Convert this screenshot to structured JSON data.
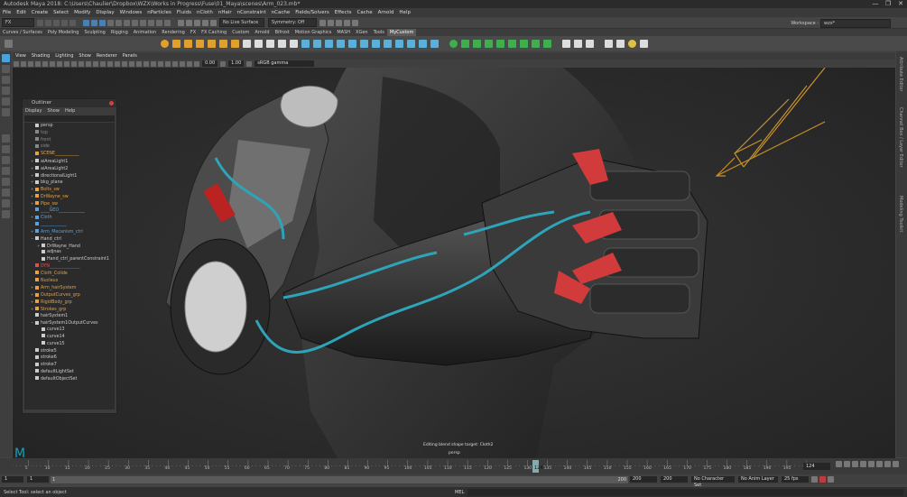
{
  "window": {
    "title": "Autodesk Maya 2018: C:\\Users\\Chaulier\\Dropbox\\WZX\\Works in Progress\\Fuse\\01_Maya\\scenes\\Arm_023.mb*",
    "buttons": [
      "—",
      "❐",
      "✕"
    ]
  },
  "menu": [
    "File",
    "Edit",
    "Create",
    "Select",
    "Modify",
    "Display",
    "Windows",
    "nParticles",
    "Fluids",
    "nCloth",
    "nHair",
    "nConstraint",
    "nCache",
    "Fields/Solvers",
    "Effects",
    "Cache",
    "Arnold",
    "Help"
  ],
  "status_line": {
    "mode": "FX",
    "live_surface": "No Live Surface",
    "symmetry": "Symmetry: Off"
  },
  "workspace": {
    "label": "Workspace :",
    "value": "wzx*"
  },
  "shelf_tabs": [
    "Curves / Surfaces",
    "Poly Modeling",
    "Sculpting",
    "Rigging",
    "Animation",
    "Rendering",
    "FX",
    "FX Caching",
    "Custom",
    "Arnold",
    "Bifrost",
    "Motion Graphics",
    "MASH",
    "XGen",
    "Tools",
    "MyCustom"
  ],
  "active_shelf_tab": "MyCustom",
  "viewport": {
    "menu": [
      "View",
      "Shading",
      "Lighting",
      "Show",
      "Renderer",
      "Panels"
    ],
    "field_a": "0.00",
    "field_b": "1.00",
    "colorspace": "sRGB gamma",
    "hud_message": "Editing blend shape target: Cloth2",
    "camera": "persp"
  },
  "right_panels": [
    "Attribute Editor",
    "Channel Box / Layer Editor",
    "Modeling Toolkit"
  ],
  "outliner": {
    "title": "Outliner",
    "menu": [
      "Display",
      "Show",
      "Help"
    ],
    "items": [
      {
        "label": "persp",
        "color": "#cccccc",
        "indent": 1,
        "expand": ""
      },
      {
        "label": "top",
        "color": "#888888",
        "indent": 1,
        "expand": ""
      },
      {
        "label": "front",
        "color": "#888888",
        "indent": 1,
        "expand": ""
      },
      {
        "label": "side",
        "color": "#888888",
        "indent": 1,
        "expand": ""
      },
      {
        "label": "SCENE___________",
        "color": "#e8a040",
        "indent": 1,
        "expand": ""
      },
      {
        "label": "aiAreaLight1",
        "color": "#cccccc",
        "indent": 1,
        "expand": "+"
      },
      {
        "label": "aiAreaLight2",
        "color": "#cccccc",
        "indent": 1,
        "expand": "+"
      },
      {
        "label": "directionalLight1",
        "color": "#cccccc",
        "indent": 1,
        "expand": "+"
      },
      {
        "label": "bkg_plane",
        "color": "#cccccc",
        "indent": 1,
        "expand": "+"
      },
      {
        "label": "Bolts_sw",
        "color": "#e8a040",
        "indent": 1,
        "expand": "+"
      },
      {
        "label": "DrWayne_sw",
        "color": "#e8a040",
        "indent": 1,
        "expand": "+"
      },
      {
        "label": "Pipe_sw",
        "color": "#e8a040",
        "indent": 1,
        "expand": "+"
      },
      {
        "label": "____GEO____________",
        "color": "#5aa0e0",
        "indent": 1,
        "expand": ""
      },
      {
        "label": "Cloth",
        "color": "#5aa0e0",
        "indent": 1,
        "expand": "+"
      },
      {
        "label": "____________",
        "color": "#5aa0e0",
        "indent": 1,
        "expand": ""
      },
      {
        "label": "Arm_Mecanism_ctrl",
        "color": "#5aa0e0",
        "indent": 1,
        "expand": "+"
      },
      {
        "label": "Hand_ctrl",
        "color": "#cccccc",
        "indent": 1,
        "expand": "−"
      },
      {
        "label": "DrWayne_Hand",
        "color": "#cccccc",
        "indent": 2,
        "expand": "+"
      },
      {
        "label": "adjnas",
        "color": "#cccccc",
        "indent": 2,
        "expand": ""
      },
      {
        "label": "Hand_ctrl_parentConstraint1",
        "color": "#cccccc",
        "indent": 2,
        "expand": ""
      },
      {
        "label": "DYN______________",
        "color": "#e05050",
        "indent": 1,
        "expand": ""
      },
      {
        "label": "Cloth_Colide",
        "color": "#e8a040",
        "indent": 1,
        "expand": ""
      },
      {
        "label": "Nucleus",
        "color": "#e8a040",
        "indent": 1,
        "expand": ""
      },
      {
        "label": "Arm_hairSystem",
        "color": "#e8a040",
        "indent": 1,
        "expand": "+"
      },
      {
        "label": "OutputCurves_grp",
        "color": "#e8a040",
        "indent": 1,
        "expand": "+"
      },
      {
        "label": "RigidBody_grp",
        "color": "#e8a040",
        "indent": 1,
        "expand": "+"
      },
      {
        "label": "Strokes_grp",
        "color": "#e8a040",
        "indent": 1,
        "expand": "+"
      },
      {
        "label": "hairSystem1",
        "color": "#cccccc",
        "indent": 1,
        "expand": ""
      },
      {
        "label": "hairSystem1OutputCurves",
        "color": "#cccccc",
        "indent": 1,
        "expand": "−"
      },
      {
        "label": "curve13",
        "color": "#cccccc",
        "indent": 2,
        "expand": ""
      },
      {
        "label": "curve14",
        "color": "#cccccc",
        "indent": 2,
        "expand": ""
      },
      {
        "label": "curve15",
        "color": "#cccccc",
        "indent": 2,
        "expand": ""
      },
      {
        "label": "stroke5",
        "color": "#cccccc",
        "indent": 1,
        "expand": ""
      },
      {
        "label": "stroke6",
        "color": "#cccccc",
        "indent": 1,
        "expand": ""
      },
      {
        "label": "stroke7",
        "color": "#cccccc",
        "indent": 1,
        "expand": ""
      },
      {
        "label": "defaultLightSet",
        "color": "#cccccc",
        "indent": 1,
        "expand": ""
      },
      {
        "label": "defaultObjectSet",
        "color": "#cccccc",
        "indent": 1,
        "expand": ""
      }
    ]
  },
  "timeline": {
    "ticks": [
      "5",
      "10",
      "15",
      "20",
      "25",
      "30",
      "35",
      "40",
      "45",
      "50",
      "55",
      "60",
      "65",
      "70",
      "75",
      "80",
      "85",
      "90",
      "95",
      "100",
      "105",
      "110",
      "115",
      "120",
      "125",
      "130",
      "135",
      "140",
      "145",
      "150",
      "155",
      "160",
      "165",
      "170",
      "175",
      "180",
      "185",
      "190",
      "195",
      "200"
    ],
    "current_frame": "124",
    "current_frame_field": "124"
  },
  "range": {
    "start": "1",
    "playback_start": "1",
    "range_label": "1",
    "range_end_label": "200",
    "playback_end": "200",
    "end": "200",
    "character_set": "No Character Set",
    "anim_layer": "No Anim Layer",
    "fps": "25 fps"
  },
  "help_line": {
    "text": "Select Tool: select an object",
    "mel": "MEL"
  }
}
